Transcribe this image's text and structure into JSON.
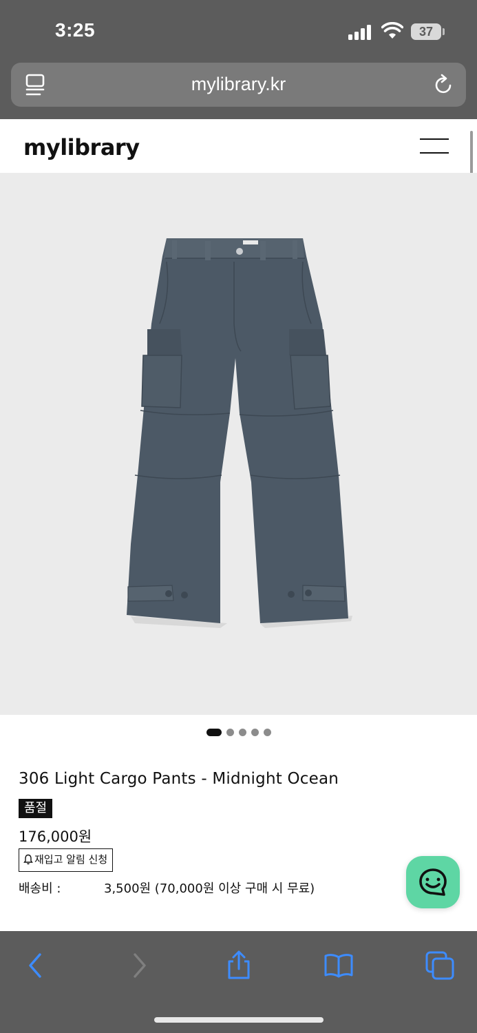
{
  "status_bar": {
    "time": "3:25",
    "battery": "37"
  },
  "browser": {
    "url": "mylibrary.kr",
    "icons": [
      "reader-mode-icon",
      "reload-icon",
      "back-icon",
      "forward-icon",
      "share-icon",
      "bookmarks-icon",
      "tabs-icon"
    ],
    "accent_color": "#3d8cff"
  },
  "site": {
    "logo": "mylibrary",
    "menu_icon": "hamburger-menu-icon"
  },
  "product": {
    "image_description": "navy cargo pants product photo",
    "gallery": {
      "total": 5,
      "active_index": 0
    },
    "title": "306 Light Cargo Pants - Midnight Ocean",
    "soldout_label": "품절",
    "price": "176,000원",
    "restock_button_label": "재입고 알림 신청",
    "shipping_label": "배송비 :",
    "shipping_value": "3,500원 (70,000원 이상 구매 시 무료)"
  },
  "chat": {
    "icon": "chat-bubble-icon",
    "color": "#5ed6a4"
  }
}
